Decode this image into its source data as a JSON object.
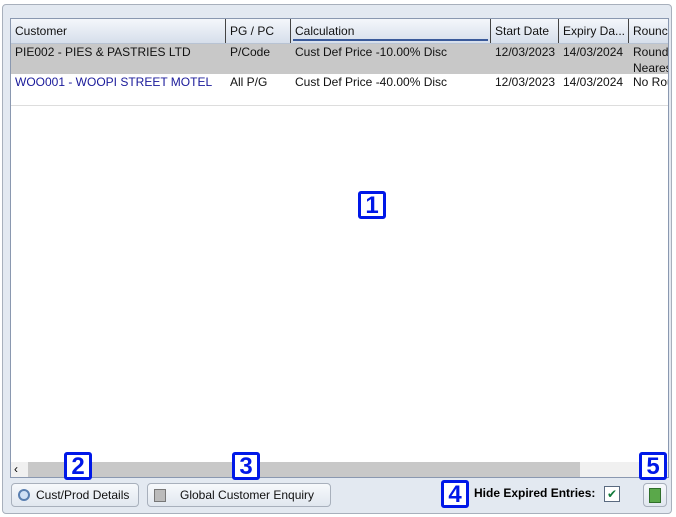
{
  "table": {
    "columns": [
      "Customer",
      "PG / PC",
      "Calculation",
      "Start Date",
      "Expiry Da...",
      "Rounc"
    ],
    "rows": [
      {
        "customer": "PIE002 - PIES & PASTRIES LTD",
        "pg": "P/Code",
        "calc": "Cust Def Price -10.00% Disc",
        "start": "12/03/2023",
        "expiry": "14/03/2024",
        "round1": "Round",
        "round2": "Neares"
      },
      {
        "customer": "WOO001 - WOOPI STREET MOTEL",
        "pg": "All P/G",
        "calc": "Cust Def Price -40.00% Disc",
        "start": "12/03/2023",
        "expiry": "14/03/2024",
        "round1": "No Rou",
        "round2": ""
      }
    ]
  },
  "footer": {
    "cust_prod": "Cust/Prod Details",
    "global": "Global Customer Enquiry",
    "hide_expired": "Hide Expired Entries:",
    "hide_expired_checked": true
  },
  "badges": [
    "1",
    "2",
    "3",
    "4",
    "5"
  ],
  "colors": {
    "selected_row": "#c8c8c8",
    "link_text": "#1a1a9a",
    "badge": "#0018e8"
  }
}
